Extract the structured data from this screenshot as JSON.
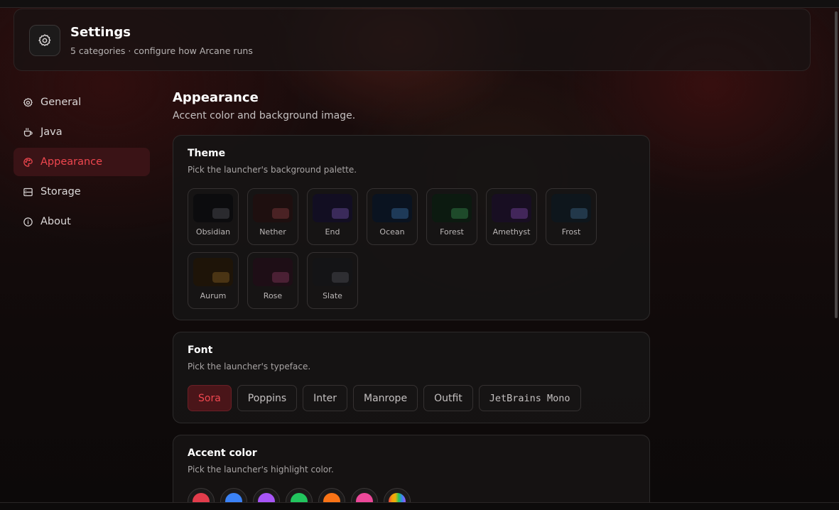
{
  "header": {
    "title": "Settings",
    "subtitle": "5 categories · configure how Arcane runs",
    "icon": "gear-icon"
  },
  "sidebar": {
    "items": [
      {
        "label": "General",
        "icon": "gear-icon",
        "active": false
      },
      {
        "label": "Java",
        "icon": "coffee-cup-icon",
        "active": false
      },
      {
        "label": "Appearance",
        "icon": "palette-icon",
        "active": true
      },
      {
        "label": "Storage",
        "icon": "hard-drive-icon",
        "active": false
      },
      {
        "label": "About",
        "icon": "info-icon",
        "active": false
      }
    ]
  },
  "main": {
    "title": "Appearance",
    "subtitle": "Accent color and background image."
  },
  "theme": {
    "title": "Theme",
    "subtitle": "Pick the launcher's background palette.",
    "options": [
      {
        "name": "Obsidian",
        "bg": "#0c0c0e",
        "chip": "#2a2a2e"
      },
      {
        "name": "Nether",
        "bg": "#1e0f0f",
        "chip": "#4a2224"
      },
      {
        "name": "End",
        "bg": "#120e22",
        "chip": "#3a2a5a"
      },
      {
        "name": "Ocean",
        "bg": "#0a1320",
        "chip": "#1e3a58"
      },
      {
        "name": "Forest",
        "bg": "#0c1a10",
        "chip": "#1e4a2a"
      },
      {
        "name": "Amethyst",
        "bg": "#180e22",
        "chip": "#42265a"
      },
      {
        "name": "Frost",
        "bg": "#0e161c",
        "chip": "#22384a"
      },
      {
        "name": "Aurum",
        "bg": "#1e1408",
        "chip": "#4a3414"
      },
      {
        "name": "Rose",
        "bg": "#1e0e16",
        "chip": "#4a2034"
      },
      {
        "name": "Slate",
        "bg": "#141416",
        "chip": "#2e2e32"
      }
    ]
  },
  "font": {
    "title": "Font",
    "subtitle": "Pick the launcher's typeface.",
    "options": [
      "Sora",
      "Poppins",
      "Inter",
      "Manrope",
      "Outfit",
      "JetBrains Mono"
    ],
    "selected": "Sora"
  },
  "accent": {
    "title": "Accent color",
    "subtitle": "Pick the launcher's highlight color.",
    "colors": [
      "#e23c4b",
      "#3b82f6",
      "#a855f7",
      "#22c55e",
      "#f97316",
      "#ec4899",
      "rainbow"
    ]
  },
  "colors": {
    "accent": "#f0474f"
  }
}
